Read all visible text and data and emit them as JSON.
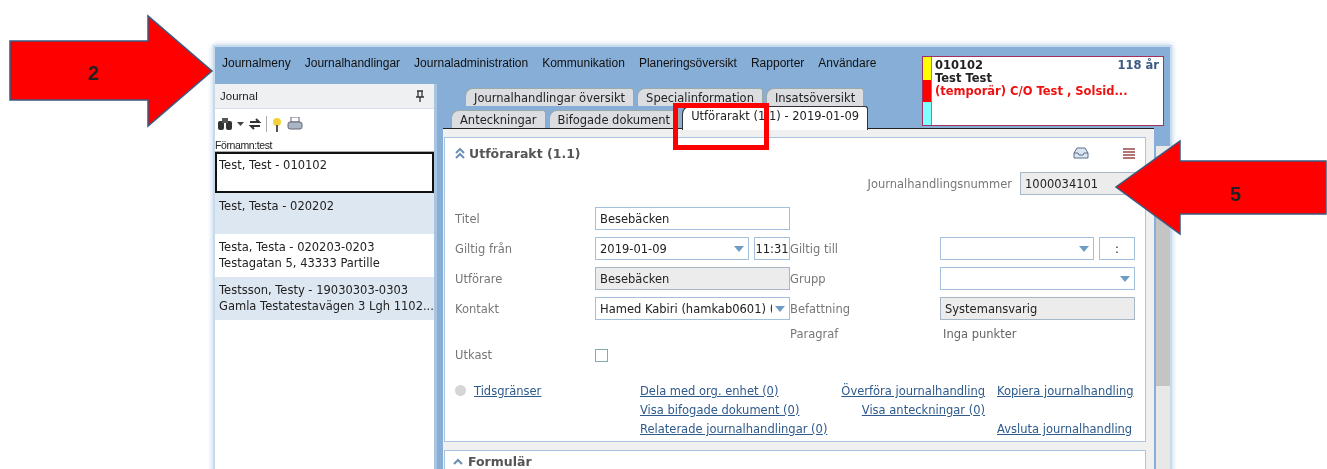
{
  "menu": [
    "Journalmeny",
    "Journalhandlingar",
    "Journaladministration",
    "Kommunikation",
    "Planeringsöversikt",
    "Rapporter",
    "Användare"
  ],
  "journal_panel": {
    "title": "Journal",
    "filter": "Förnamn:test",
    "patients": [
      {
        "lines": [
          "Test, Test - 010102"
        ],
        "selected": true
      },
      {
        "lines": [
          "Test, Testa - 020202"
        ],
        "selected": false
      },
      {
        "lines": [
          "Testa, Testa - 020203-0203",
          "Testagatan 5, 43333 Partille"
        ],
        "selected": false
      },
      {
        "lines": [
          "Testsson, Testy - 19030303-0303",
          "Gamla Testatestavägen 3 Lgh 1102..."
        ],
        "selected": false
      }
    ]
  },
  "tabs": [
    [
      {
        "label": "Journalhandlingar översikt",
        "selected": false
      },
      {
        "label": "Specialinformation",
        "selected": false
      },
      {
        "label": "Insatsöversikt",
        "selected": false
      }
    ],
    [
      {
        "label": "Anteckningar",
        "selected": false
      },
      {
        "label": "Bifogade dokument",
        "selected": false
      },
      {
        "label": "Utförarakt (1.1) - 2019-01-09",
        "selected": true
      }
    ]
  ],
  "patient_card": {
    "id": "010102",
    "age": "118 år",
    "name": "Test Test",
    "address": "(temporär) C/O Test , Solsid...",
    "flags": [
      {
        "color": "#ffff00"
      },
      {
        "color": "#ff0000"
      },
      {
        "color": "#80ffff"
      }
    ]
  },
  "section": {
    "title": "Utförarakt (1.1)",
    "expanded": true,
    "number_label": "Journalhandlingsnummer",
    "number_value": "1000034101",
    "rows": [
      {
        "left": {
          "label": "Titel",
          "kind": "text",
          "value": "Besebäcken"
        }
      },
      {
        "left": {
          "label": "Giltig från",
          "kind": "datetime",
          "value": "2019-01-09",
          "time": "11:31"
        },
        "right": {
          "label": "Giltig till",
          "kind": "datetime",
          "time": ":"
        }
      },
      {
        "left": {
          "label": "Utförare",
          "kind": "readonly",
          "value": "Besebäcken"
        },
        "right": {
          "label": "Grupp",
          "kind": "select"
        }
      },
      {
        "left": {
          "label": "Kontakt",
          "kind": "select",
          "value": "Hamed Kabiri (hamkab0601) ("
        },
        "right": {
          "label": "Befattning",
          "kind": "readonly",
          "value": "Systemansvarig"
        }
      },
      {
        "right": {
          "label": "Paragraf",
          "kind": "static",
          "value": "Inga punkter"
        }
      },
      {
        "left": {
          "label": "Utkast",
          "kind": "checkbox",
          "checked": false
        }
      }
    ],
    "deadline_link": "Tidsgränser",
    "link_columns": [
      [
        "Dela med org. enhet (0)",
        "Visa bifogade dokument (0)",
        "Relaterade journalhandlingar (0)"
      ],
      [
        "Överföra journalhandling",
        "Visa anteckningar (0)"
      ],
      [
        "Kopiera journalhandling",
        "Avsluta journalhandling"
      ]
    ]
  },
  "next_section": {
    "title": "Formulär",
    "expanded": true
  },
  "annotations": [
    {
      "label": "2"
    },
    {
      "label": "5"
    }
  ]
}
